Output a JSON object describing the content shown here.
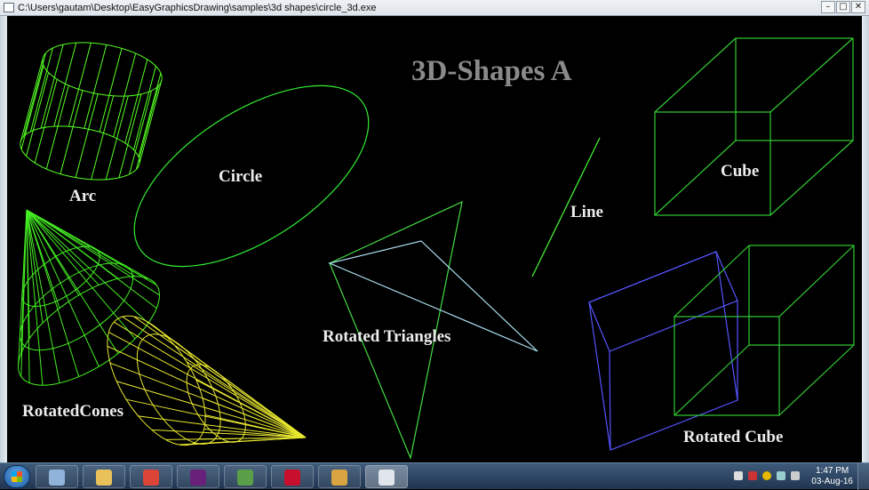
{
  "window": {
    "title_path": "C:\\Users\\gautam\\Desktop\\EasyGraphicsDrawing\\samples\\3d shapes\\circle_3d.exe",
    "minimize_glyph": "–",
    "maximize_glyph": "□",
    "close_glyph": "✕"
  },
  "canvas": {
    "title": "3D-Shapes A",
    "labels": {
      "arc": "Arc",
      "circle": "Circle",
      "line": "Line",
      "cube": "Cube",
      "rotated_triangles": "Rotated Triangles",
      "rotated_cones": "RotatedCones",
      "rotated_cube": "Rotated Cube"
    }
  },
  "colors": {
    "green": "#33ee33",
    "bright_green": "#55ff22",
    "yellow": "#e8e830",
    "blue": "#5555ff",
    "cyan": "#aaddee",
    "label": "#ececec",
    "title": "#8a8a8a"
  },
  "taskbar": {
    "apps": [
      {
        "name": "calculator-icon",
        "color": "#8fb3d9"
      },
      {
        "name": "file-explorer-icon",
        "color": "#e8c15a"
      },
      {
        "name": "chrome-icon",
        "color": "#db4437"
      },
      {
        "name": "visual-studio-icon",
        "color": "#68217a"
      },
      {
        "name": "network-icon",
        "color": "#5a9e4a"
      },
      {
        "name": "adobe-reader-icon",
        "color": "#c8102e"
      },
      {
        "name": "paint-icon",
        "color": "#d9a441"
      },
      {
        "name": "circle-3d-app-icon",
        "color": "#e0e6ec"
      }
    ],
    "time": "1:47 PM",
    "date": "03-Aug-16"
  }
}
